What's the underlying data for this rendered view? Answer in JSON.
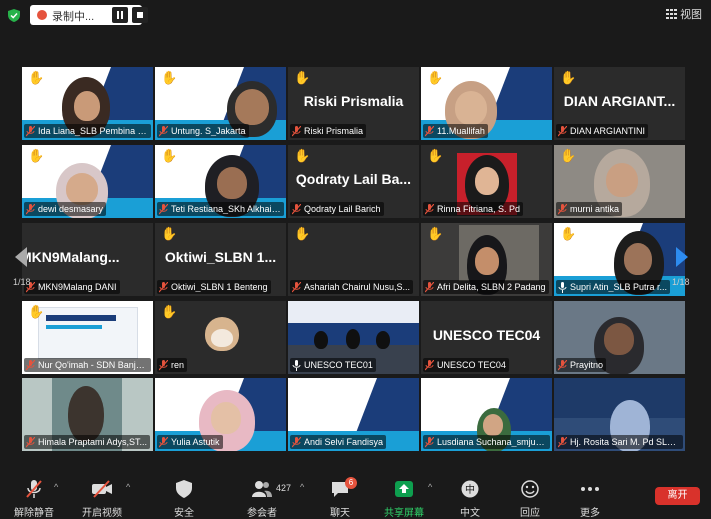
{
  "topbar": {
    "recording_label": "录制中...",
    "view_label": "视图"
  },
  "navigation": {
    "page_indicator_left": "1/18",
    "page_indicator_right": "1/18"
  },
  "participants": [
    {
      "name": "Ida Liana_SLB Pembina S...",
      "hand": true,
      "display": "video"
    },
    {
      "name": "Untung. S_Jakarta",
      "hand": true,
      "display": "video"
    },
    {
      "name": "Riski Prismalia",
      "display_name": "Riski Prismalia",
      "hand": true,
      "display": "name"
    },
    {
      "name": "11.Muallifah",
      "hand": true,
      "display": "video"
    },
    {
      "name": "DIAN ARGIANTINI",
      "display_name": "DIAN ARGIANT...",
      "hand": true,
      "display": "name"
    },
    {
      "name": "dewi desmasary",
      "hand": true,
      "display": "video"
    },
    {
      "name": "Teti Restiana_SKh Alkhairi...",
      "hand": true,
      "display": "video"
    },
    {
      "name": "Qodraty Lail Barich",
      "display_name": "Qodraty Lail Ba...",
      "hand": true,
      "display": "name"
    },
    {
      "name": "Rinna Fitriana, S. Pd",
      "hand": true,
      "display": "video"
    },
    {
      "name": "murni antika",
      "hand": true,
      "display": "video"
    },
    {
      "name": "MKN9Malang DANI",
      "display_name": "MKN9Malang...",
      "hand": false,
      "display": "name"
    },
    {
      "name": "Oktiwi_SLBN 1 Benteng",
      "display_name": "Oktiwi_SLBN 1...",
      "hand": true,
      "display": "name"
    },
    {
      "name": "Ashariah Chairul Nusu,S...",
      "hand": true,
      "display": "blank"
    },
    {
      "name": "Afri Delita, SLBN 2 Padang",
      "hand": true,
      "display": "video"
    },
    {
      "name": "Supri Atin_SLB Putra r...",
      "hand": true,
      "display": "video",
      "active": true
    },
    {
      "name": "Nur Qo'imah - SDN Banja...",
      "hand": true,
      "display": "video"
    },
    {
      "name": "ren",
      "hand": true,
      "display": "video"
    },
    {
      "name": "UNESCO TEC01",
      "hand": false,
      "display": "video"
    },
    {
      "name": "UNESCO TEC04",
      "display_name": "UNESCO TEC04",
      "hand": false,
      "display": "name"
    },
    {
      "name": "Prayitno",
      "hand": false,
      "display": "video"
    },
    {
      "name": "Himala Praptami Adys,ST...",
      "hand": false,
      "display": "video"
    },
    {
      "name": "Yulia Astutik",
      "hand": false,
      "display": "video"
    },
    {
      "name": "Andi Selvi Fandisya",
      "hand": false,
      "display": "video"
    },
    {
      "name": "Lusdiana Suchana_smjun2...",
      "hand": false,
      "display": "video"
    },
    {
      "name": "Hj. Rosita Sari M. Pd SLBC...",
      "hand": false,
      "display": "video"
    }
  ],
  "toolbar": {
    "unmute_label": "解除静音",
    "start_video_label": "开启视频",
    "security_label": "安全",
    "participants_label": "参会者",
    "participants_count": "427",
    "chat_label": "聊天",
    "chat_badge": "6",
    "share_label": "共享屏幕",
    "translate_label": "中文",
    "reactions_label": "回应",
    "more_label": "更多",
    "leave_label": "离开"
  },
  "colors": {
    "background": "#1a1a1a",
    "tile_background": "#2b2b2b",
    "share_accent": "#0e9f4f",
    "leave_red": "#d9322b",
    "active_speaker_outline": "#c8dc3a",
    "mic_off_red": "#e5533d"
  }
}
